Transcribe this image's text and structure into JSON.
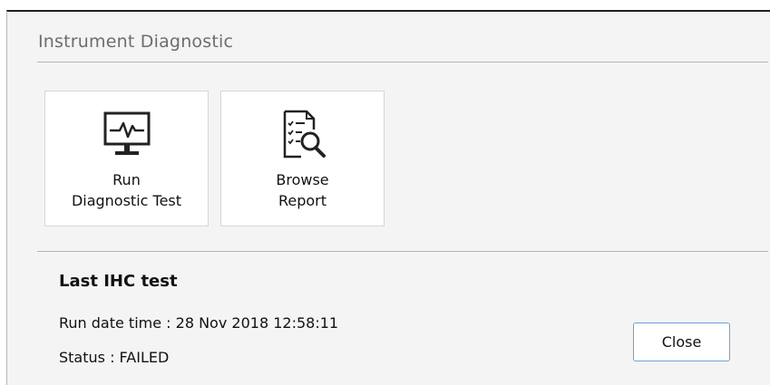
{
  "dialog": {
    "title": "Instrument Diagnostic"
  },
  "tiles": [
    {
      "icon": "monitor-heartbeat-icon",
      "label_line1": "Run",
      "label_line2": "Diagnostic Test"
    },
    {
      "icon": "report-search-icon",
      "label_line1": "Browse",
      "label_line2": "Report"
    }
  ],
  "last_test": {
    "heading": "Last IHC test",
    "run_date_time": "Run date time : 28 Nov 2018 12:58:11",
    "status": "Status : FAILED"
  },
  "actions": {
    "close_label": "Close"
  },
  "colors": {
    "dialog_bg": "#f4f4f4",
    "tile_bg": "#ffffff",
    "title_text": "#6d6d6d",
    "focus_border": "#6aa3d8"
  }
}
